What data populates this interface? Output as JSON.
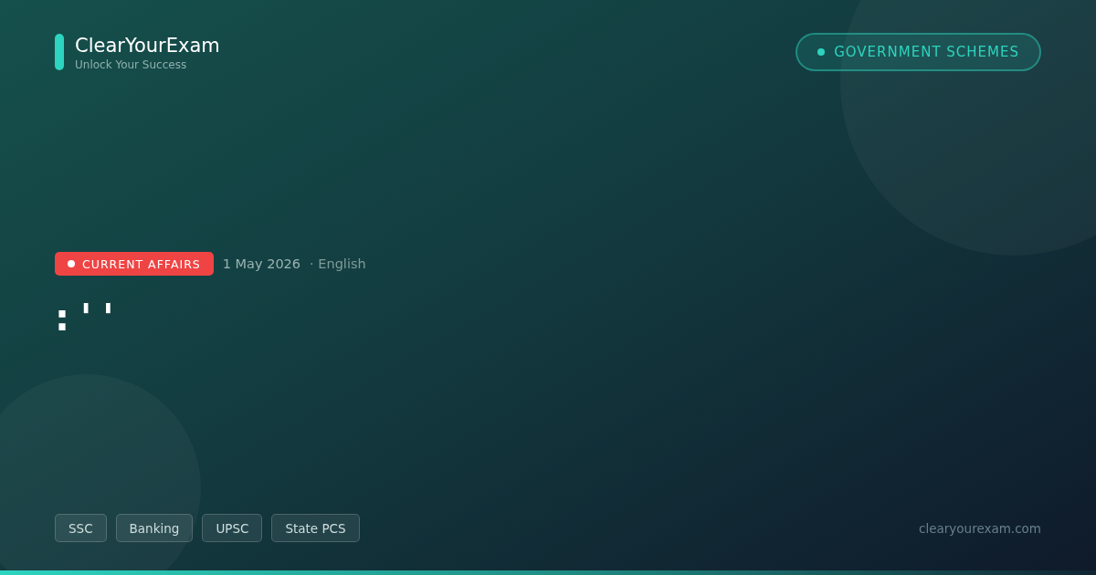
{
  "brand": {
    "name": "ClearYourExam",
    "tagline": "Unlock Your Success"
  },
  "category_pill": "GOVERNMENT SCHEMES",
  "meta": {
    "badge": "CURRENT AFFAIRS",
    "date": "1 May 2026",
    "language": "· English"
  },
  "headline": ":''",
  "tags": [
    "SSC",
    "Banking",
    "UPSC",
    "State PCS"
  ],
  "website": "clearyourexam.com"
}
